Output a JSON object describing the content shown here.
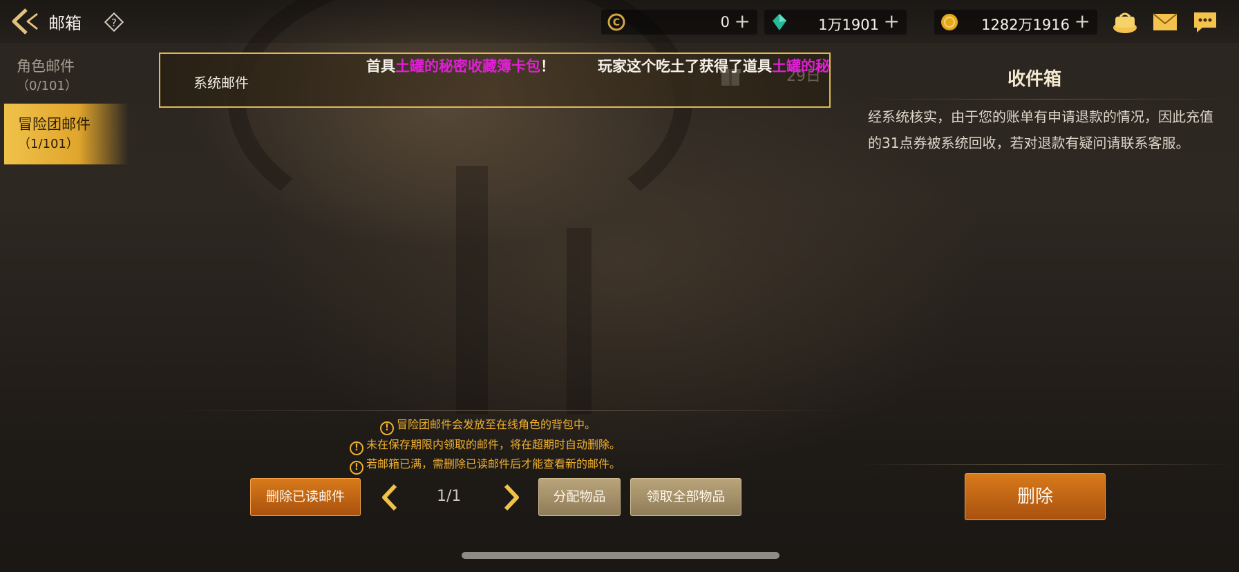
{
  "header": {
    "title": "邮箱",
    "help_label": "?"
  },
  "currencies": [
    {
      "icon": "c-coin-icon",
      "value": "0"
    },
    {
      "icon": "crystal-icon",
      "value": "1万1901"
    },
    {
      "icon": "gold-coin-icon",
      "value": "1282万1916"
    }
  ],
  "plus_symbol": "+",
  "top_icons": [
    "bag-icon",
    "mail-icon",
    "chat-icon"
  ],
  "tabs": [
    {
      "label": "角色邮件",
      "count": "（0/101）"
    },
    {
      "label": "冒险团邮件",
      "count": "（1/101）"
    }
  ],
  "mail_list": [
    {
      "sender": "系统邮件",
      "date": "29日"
    }
  ],
  "ticker": {
    "part1_prefix": "首具",
    "part1_highlight": "土罐的秘密收藏簿卡包",
    "part1_suffix": "！",
    "part2_prefix": "玩家这个吃土了获得了道具",
    "part2_highlight": "土罐的秘"
  },
  "detail": {
    "title": "收件箱",
    "body": "经系统核实，由于您的账单有申请退款的情况，因此充值的31点券被系统回收，若对退款有疑问请联系客服。",
    "delete_label": "删除"
  },
  "notices": [
    "冒险团邮件会发放至在线角色的背包中。",
    "未在保存期限内领取的邮件，将在超期时自动删除。",
    "若邮箱已满，需删除已读邮件后才能查看新的邮件。"
  ],
  "notice_icon": "!",
  "footer": {
    "delete_read_label": "删除已读邮件",
    "page": "1/1",
    "distribute_label": "分配物品",
    "claim_all_label": "领取全部物品"
  },
  "colors": {
    "accent_gold": "#e0b957",
    "highlight_magenta": "#e01fd6",
    "notice_orange": "#f0b02f",
    "button_orange": "#d87a1b"
  }
}
